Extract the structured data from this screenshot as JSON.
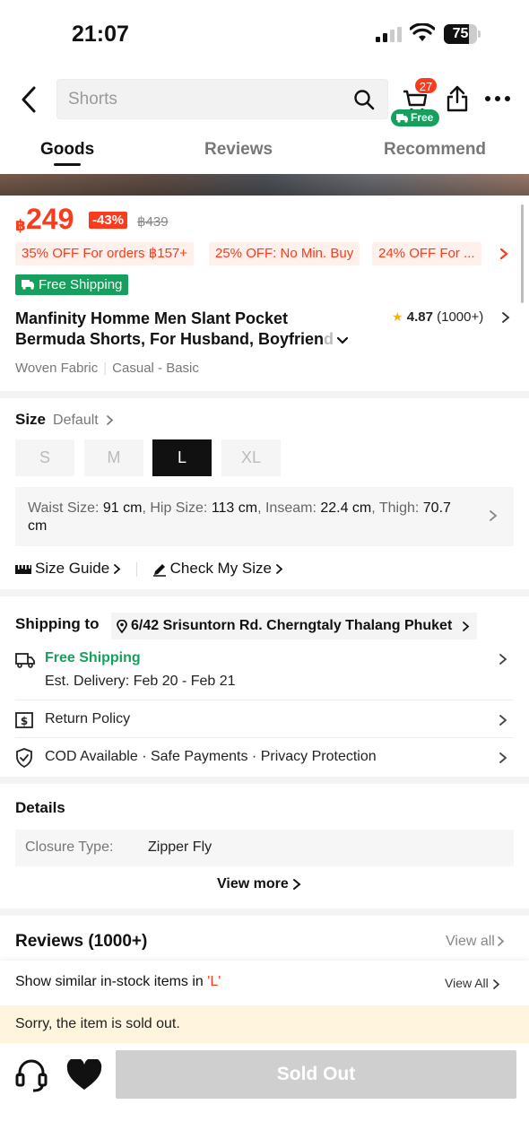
{
  "status_bar": {
    "time": "21:07",
    "battery": "75",
    "battery_level_percent": 75
  },
  "header": {
    "search_placeholder": "Shorts",
    "cart_count": "27",
    "cart_free_label": "Free"
  },
  "tabs": [
    {
      "label": "Goods",
      "active": true
    },
    {
      "label": "Reviews",
      "active": false
    },
    {
      "label": "Recommend",
      "active": false
    }
  ],
  "price": {
    "currency": "฿",
    "amount": "249",
    "discount": "-43%",
    "original": "฿439"
  },
  "promos": [
    "35% OFF For orders ฿157+",
    "25% OFF: No Min. Buy",
    "24% OFF For ..."
  ],
  "free_shipping_badge": "Free Shipping",
  "product": {
    "title_line1": "Manfinity Homme Men Slant Pocket",
    "title_line2": "Bermuda Shorts, For Husband, Boyfrien",
    "title_fade": "d",
    "rating_score": "4.87",
    "rating_count": "(1000+)",
    "attributes": [
      "Woven Fabric",
      "Casual - Basic"
    ]
  },
  "size": {
    "heading": "Size",
    "default_label": "Default",
    "options": [
      {
        "label": "S",
        "selected": false
      },
      {
        "label": "M",
        "selected": false
      },
      {
        "label": "L",
        "selected": true
      },
      {
        "label": "XL",
        "selected": false
      }
    ],
    "measure": {
      "waist_label": "Waist Size: ",
      "waist": "91 cm",
      "hip_label": ", Hip Size: ",
      "hip": "113 cm",
      "inseam_label": ", Inseam: ",
      "inseam": "22.4 cm",
      "thigh_label": ", Thigh: ",
      "thigh": "70.7 cm"
    },
    "size_guide": "Size Guide",
    "check_size": "Check My Size"
  },
  "shipping": {
    "heading": "Shipping to",
    "address": "6/42 Srisuntorn Rd. Cherngtaly Thalang Phuket",
    "free_shipping": "Free Shipping",
    "est_delivery": "Est. Delivery: Feb 20 - Feb 21",
    "return_policy": "Return Policy",
    "cod": "COD Available · Safe Payments · Privacy Protection"
  },
  "details": {
    "heading": "Details",
    "rows": [
      {
        "key": "Closure Type:",
        "value": "Zipper Fly"
      }
    ],
    "view_more": "View more"
  },
  "reviews": {
    "heading": "Reviews (1000+)",
    "view_all": "View all"
  },
  "similar": {
    "text": "Show similar in-stock items in ",
    "size": "'L'",
    "view_all": "View All"
  },
  "sold_notice": "Sorry, the item is sold out.",
  "bottom": {
    "button": "Sold Out"
  },
  "colors": {
    "accent": "#fa3b1d",
    "green": "#17a05d",
    "notice_bg": "#fff4dd"
  }
}
